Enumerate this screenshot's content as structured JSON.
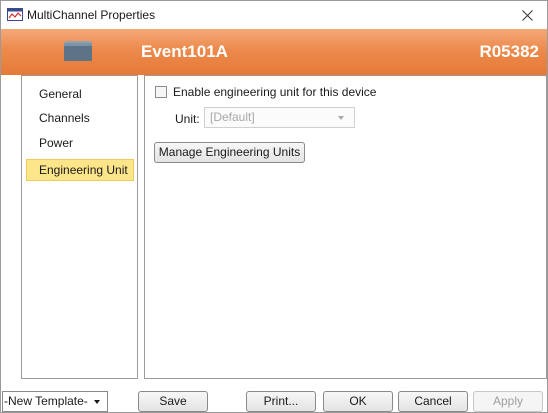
{
  "window": {
    "title": "MultiChannel Properties",
    "close_symbol": "✕"
  },
  "header": {
    "device_name": "Event101A",
    "serial": "R05382",
    "device_icon": "device-icon",
    "accent_color": "#e67a37"
  },
  "sidebar": {
    "items": [
      {
        "label": "General"
      },
      {
        "label": "Channels"
      },
      {
        "label": "Power"
      },
      {
        "label": "Engineering Unit",
        "selected": true
      }
    ],
    "selected_color": "#fde58a"
  },
  "content": {
    "enable_label": "Enable engineering unit for this device",
    "enable_checked": false,
    "unit_label": "Unit:",
    "unit_value": "[Default]",
    "manage_button": "Manage Engineering Units"
  },
  "footer": {
    "template_value": "-New Template-",
    "save": "Save",
    "print": "Print...",
    "ok": "OK",
    "cancel": "Cancel",
    "apply": "Apply"
  }
}
